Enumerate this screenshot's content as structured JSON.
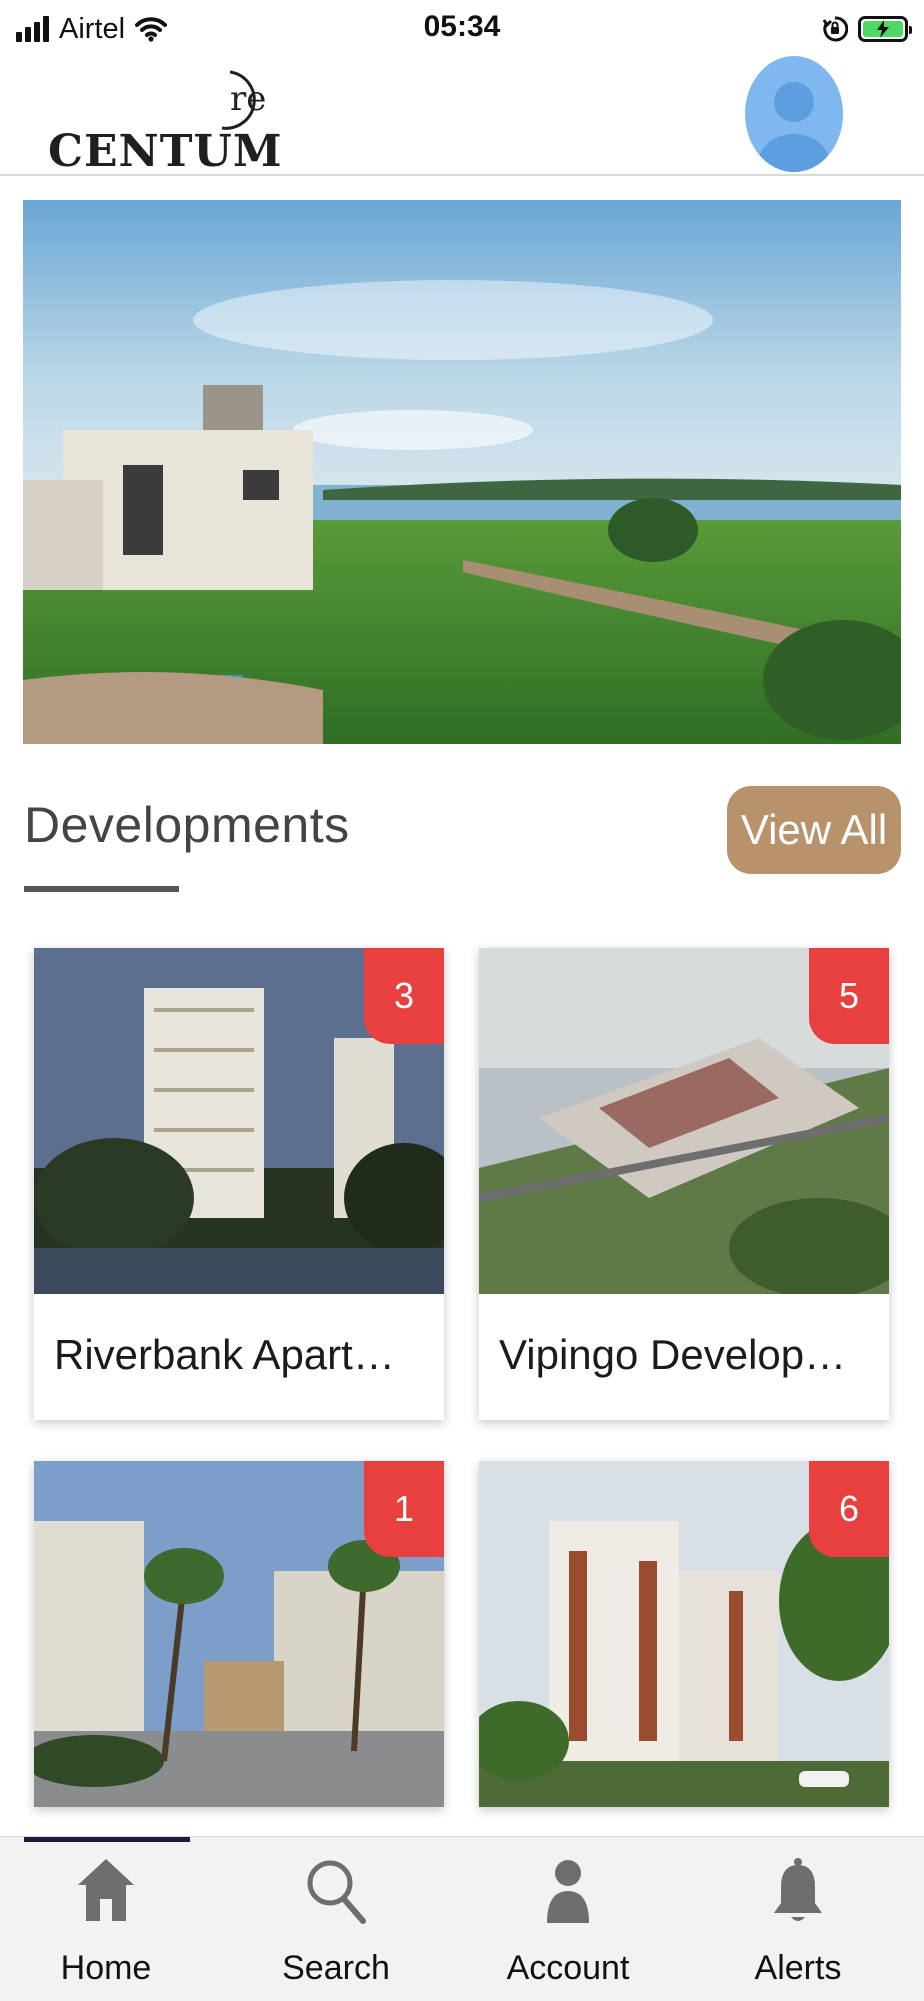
{
  "status_bar": {
    "carrier": "Airtel",
    "time": "05:34",
    "icons": [
      "signal-icon",
      "wifi-icon",
      "orientation-lock-icon",
      "battery-charging-icon"
    ],
    "battery_color": "#4cd964"
  },
  "header": {
    "logo_text": "CENTUM",
    "logo_mark": "re",
    "avatar_icon": "user-avatar-icon",
    "avatar_color": "#7fb8ee"
  },
  "hero": {
    "image": "lakeside villa with lawn and lake view"
  },
  "developments": {
    "title": "Developments",
    "view_all_label": "View All",
    "accent_color": "#b7926b",
    "badge_color": "#e8403f",
    "cards": [
      {
        "name": "Riverbank Apartme...",
        "count": "3"
      },
      {
        "name": "Vipingo Development",
        "count": "5"
      },
      {
        "name": "",
        "count": "1"
      },
      {
        "name": "",
        "count": "6"
      }
    ]
  },
  "bottom_nav": {
    "active": "Home",
    "items": [
      {
        "label": "Home",
        "icon": "home-icon"
      },
      {
        "label": "Search",
        "icon": "search-icon"
      },
      {
        "label": "Account",
        "icon": "person-icon"
      },
      {
        "label": "Alerts",
        "icon": "bell-icon"
      }
    ]
  }
}
